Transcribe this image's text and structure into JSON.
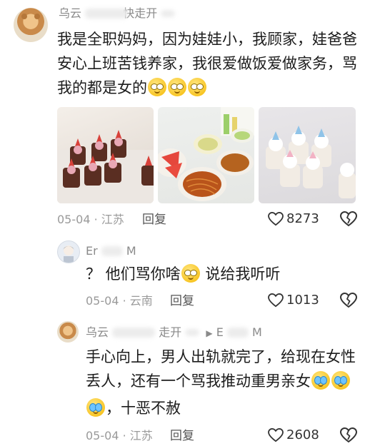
{
  "comment1": {
    "username_visible": "乌云",
    "username_tail": "快走开",
    "text_line1": "我是全职妈妈，因为娃娃小，我顾家，娃爸爸",
    "text_line2": "安心上班苦钱养家，我很爱做饭爱做家务，骂",
    "text_line3": "我的都是女的",
    "emoji_count": 3,
    "date_location": "05-04 · 江苏",
    "reply_label": "回复",
    "likes": "8273",
    "photos": [
      "dessert-cakes-photo",
      "home-dinner-photo",
      "cupcakes-photo"
    ]
  },
  "reply1": {
    "username_visible": "Er",
    "username_tail": "M",
    "text_before": "？ 他们骂你啥",
    "text_after": " 说给我听听",
    "date_location": "05-04 · 云南",
    "reply_label": "回复",
    "likes": "1013"
  },
  "reply2": {
    "username_visible": "乌云",
    "username_tail": "走开",
    "reply_to_visible": "E",
    "reply_to_tail": "M",
    "text_line1": "手心向上，男人出轨就完了，给现在女性",
    "text_line2": "丢人，还有一个骂我推动重男亲女",
    "text_line3": "，十恶不赦",
    "date_location": "05-04 · 江苏",
    "reply_label": "回复",
    "likes": "2608"
  },
  "colors": {
    "like_icon": "#333333",
    "meta_gray": "#9a9a9a",
    "name_gray": "#8a8a8a"
  }
}
